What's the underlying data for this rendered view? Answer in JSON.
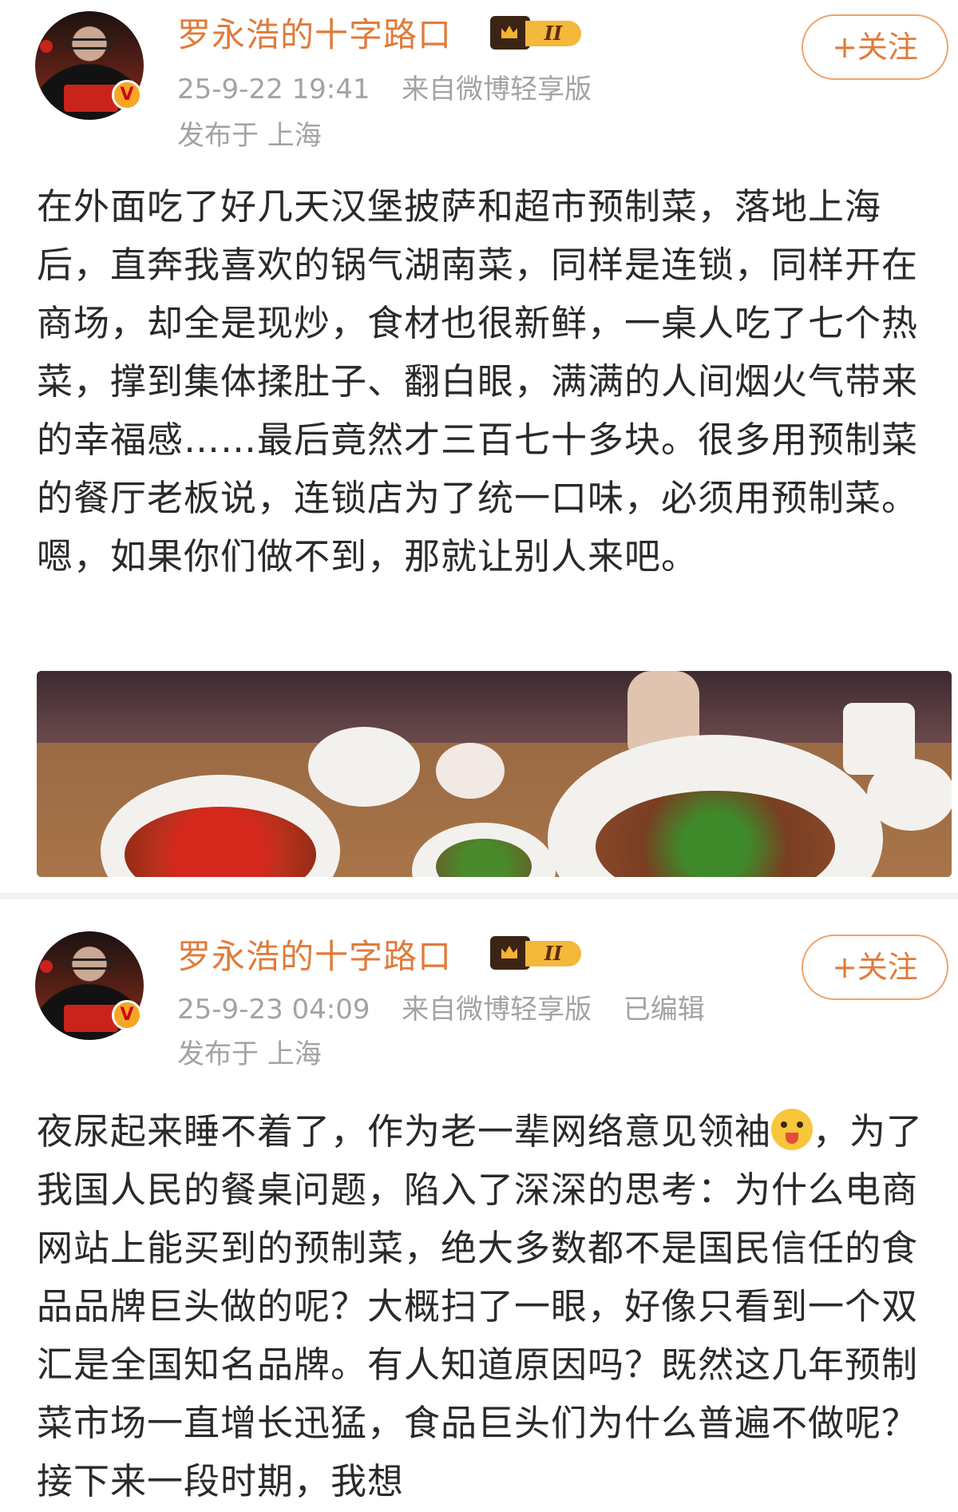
{
  "posts": [
    {
      "username": "罗永浩的十字路口",
      "level": "II",
      "timestamp": "25-9-22 19:41",
      "source": "来自微博轻享版",
      "edited": "",
      "location": "发布于 上海",
      "follow_label": "+关注",
      "verified_mark": "V",
      "content": "在外面吃了好几天汉堡披萨和超市预制菜，落地上海后，直奔我喜欢的锅气湖南菜，同样是连锁，同样开在商场，却全是现炒，食材也很新鲜，一桌人吃了七个热菜，撑到集体揉肚子、翻白眼，满满的人间烟火气带来的幸福感……最后竟然才三百七十多块。很多用预制菜的餐厅老板说，连锁店为了统一口味，必须用预制菜。嗯，如果你们做不到，那就让别人来吧。",
      "has_photo": true
    },
    {
      "username": "罗永浩的十字路口",
      "level": "II",
      "timestamp": "25-9-23 04:09",
      "source": "来自微博轻享版",
      "edited": "已编辑",
      "location": "发布于 上海",
      "follow_label": "+关注",
      "verified_mark": "V",
      "content_before_emoji": "夜尿起来睡不着了，作为老一辈网络意见领袖",
      "emoji": "tongue-out-emoji",
      "content_after_emoji": "，为了我国人民的餐桌问题，陷入了深深的思考：为什么电商网站上能买到的预制菜，绝大多数都不是国民信任的食品品牌巨头做的呢？大概扫了一眼，好像只看到一个双汇是全国知名品牌。有人知道原因吗？既然这几年预制菜市场一直增长迅猛，食品巨头们为什么普遍不做呢？接下来一段时期，我想",
      "has_photo": false
    }
  ],
  "colors": {
    "username": "#e07b3a",
    "meta": "#a3a3a3",
    "follow_border": "#f0a36b",
    "body_text": "#2a2a2a"
  }
}
